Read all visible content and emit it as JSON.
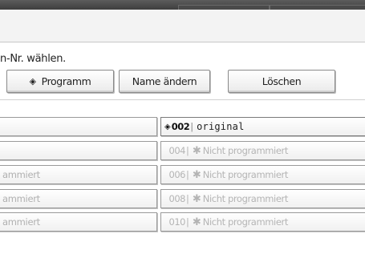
{
  "instruction": "n-Nr. wählen.",
  "buttons": {
    "program": "Programm",
    "rename": "Name ändern",
    "delete": "Löschen"
  },
  "left_column": [
    {
      "label": ""
    },
    {
      "label": ""
    },
    {
      "label": "ammiert"
    },
    {
      "label": "ammiert"
    },
    {
      "label": "ammiert"
    }
  ],
  "right_column": [
    {
      "number": "002",
      "star": "",
      "name": "original",
      "programmed": true
    },
    {
      "number": "004",
      "star": "✱",
      "name": "Nicht programmiert",
      "programmed": false
    },
    {
      "number": "006",
      "star": "✱",
      "name": "Nicht programmiert",
      "programmed": false
    },
    {
      "number": "008",
      "star": "✱",
      "name": "Nicht programmiert",
      "programmed": false
    },
    {
      "number": "010",
      "star": "✱",
      "name": "Nicht programmiert",
      "programmed": false
    }
  ],
  "icons": {
    "program_icon": "diamond-icon",
    "programmed_marker": "diamond-icon"
  },
  "colors": {
    "top_bar": "#4a4a4a",
    "disabled_text": "#b0b0b0",
    "active_text": "#111111"
  }
}
